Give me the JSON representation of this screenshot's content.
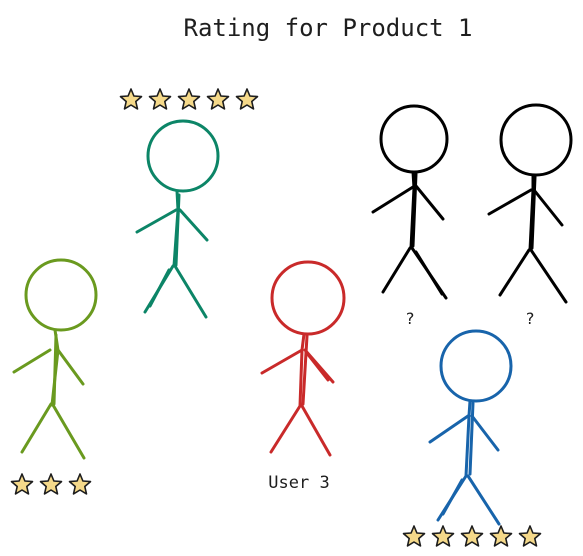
{
  "title": "Rating for Product 1",
  "star_color": "#f5d98a",
  "star_stroke": "#1e1e1e",
  "figures": [
    {
      "id": "green-left",
      "color": "#6a9a1f",
      "rating": 3,
      "label": ""
    },
    {
      "id": "teal",
      "color": "#0c8567",
      "rating": 5,
      "label": ""
    },
    {
      "id": "red",
      "color": "#c92a2a",
      "rating": null,
      "label": "User 3"
    },
    {
      "id": "black-1",
      "color": "#000000",
      "rating": null,
      "label": "?"
    },
    {
      "id": "black-2",
      "color": "#000000",
      "rating": null,
      "label": "?"
    },
    {
      "id": "blue",
      "color": "#1864ab",
      "rating": 5,
      "label": ""
    }
  ]
}
